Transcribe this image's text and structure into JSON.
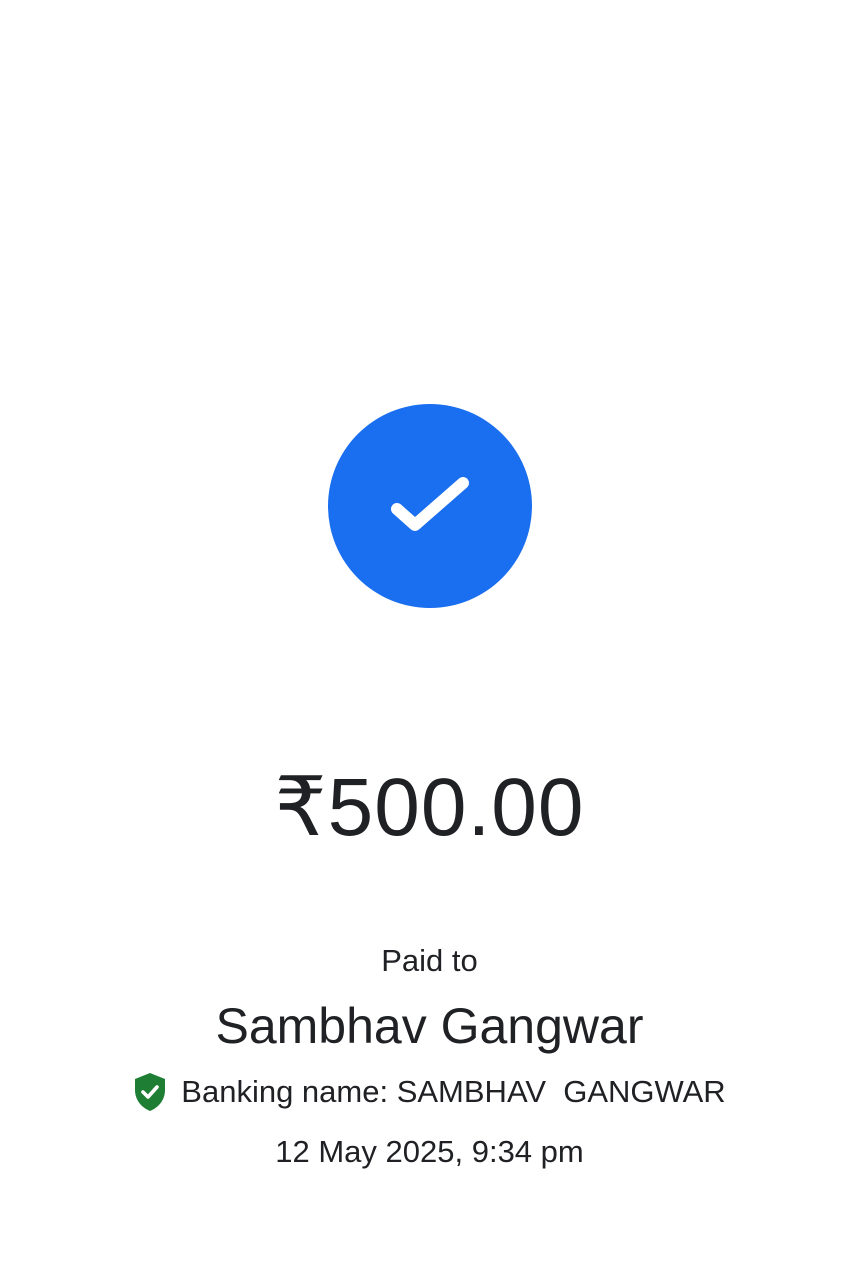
{
  "colors": {
    "accent": "#1a6ef0",
    "verified": "#1e7e34",
    "text": "#202124"
  },
  "status": {
    "icon": "check-icon"
  },
  "payment": {
    "amount": "₹500.00",
    "paid_to_label": "Paid to",
    "payee_name": "Sambhav Gangwar",
    "banking_name": "Banking name: SAMBHAV  GANGWAR",
    "banking_icon": "verified-shield-icon",
    "timestamp": "12 May 2025, 9:34 pm"
  }
}
